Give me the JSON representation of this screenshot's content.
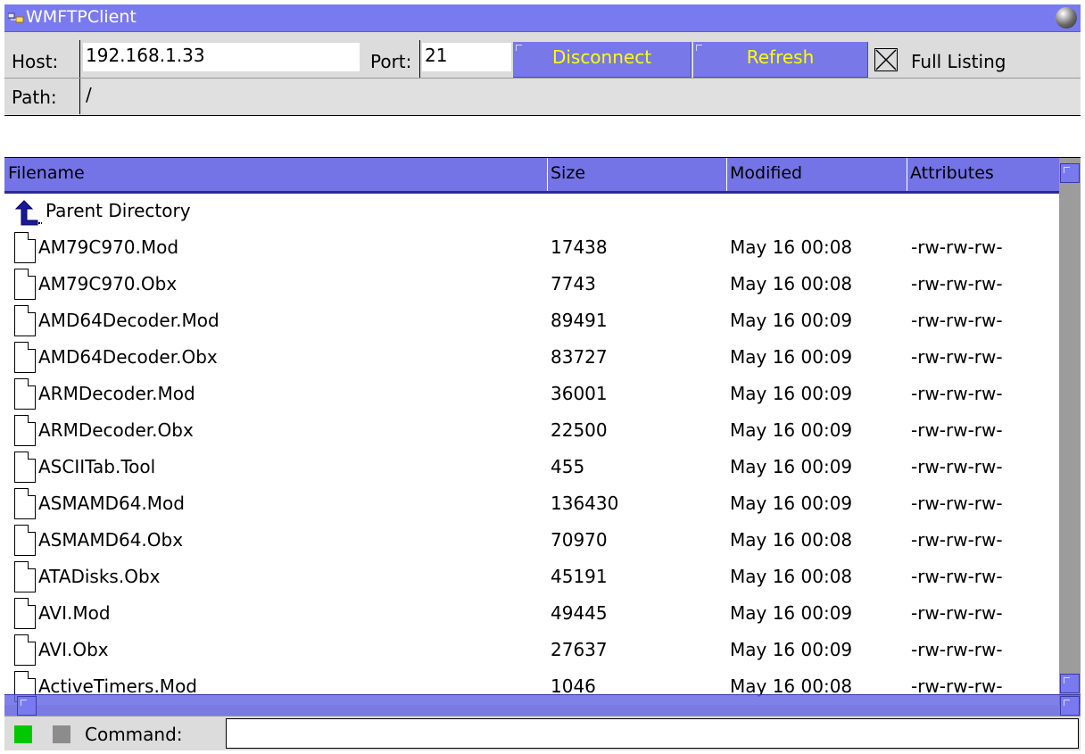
{
  "window": {
    "title": "WMFTPClient",
    "close_icon": "sphere-close-icon"
  },
  "connection": {
    "host_label": "Host:",
    "host_value": "192.168.1.33",
    "port_label": "Port:",
    "port_value": "21",
    "disconnect_label": "Disconnect",
    "refresh_label": "Refresh",
    "full_listing_label": "Full Listing",
    "full_listing_checked": true,
    "path_label": "Path:",
    "path_value": "/"
  },
  "table": {
    "columns": [
      "Filename",
      "Size",
      "Modified",
      "Attributes"
    ],
    "parent_label": "Parent Directory",
    "rows": [
      {
        "name": "AM79C970.Mod",
        "size": "17438",
        "modified": "May 16 00:08",
        "attrs": "-rw-rw-rw-"
      },
      {
        "name": "AM79C970.Obx",
        "size": "7743",
        "modified": "May 16 00:08",
        "attrs": "-rw-rw-rw-"
      },
      {
        "name": "AMD64Decoder.Mod",
        "size": "89491",
        "modified": "May 16 00:09",
        "attrs": "-rw-rw-rw-"
      },
      {
        "name": "AMD64Decoder.Obx",
        "size": "83727",
        "modified": "May 16 00:09",
        "attrs": "-rw-rw-rw-"
      },
      {
        "name": "ARMDecoder.Mod",
        "size": "36001",
        "modified": "May 16 00:09",
        "attrs": "-rw-rw-rw-"
      },
      {
        "name": "ARMDecoder.Obx",
        "size": "22500",
        "modified": "May 16 00:09",
        "attrs": "-rw-rw-rw-"
      },
      {
        "name": "ASCIITab.Tool",
        "size": "455",
        "modified": "May 16 00:09",
        "attrs": "-rw-rw-rw-"
      },
      {
        "name": "ASMAMD64.Mod",
        "size": "136430",
        "modified": "May 16 00:09",
        "attrs": "-rw-rw-rw-"
      },
      {
        "name": "ASMAMD64.Obx",
        "size": "70970",
        "modified": "May 16 00:08",
        "attrs": "-rw-rw-rw-"
      },
      {
        "name": "ATADisks.Obx",
        "size": "45191",
        "modified": "May 16 00:08",
        "attrs": "-rw-rw-rw-"
      },
      {
        "name": "AVI.Mod",
        "size": "49445",
        "modified": "May 16 00:09",
        "attrs": "-rw-rw-rw-"
      },
      {
        "name": "AVI.Obx",
        "size": "27637",
        "modified": "May 16 00:09",
        "attrs": "-rw-rw-rw-"
      },
      {
        "name": "ActiveTimers.Mod",
        "size": "1046",
        "modified": "May 16 00:08",
        "attrs": "-rw-rw-rw-"
      }
    ]
  },
  "status": {
    "command_label": "Command:",
    "command_value": "",
    "indicator_colors": [
      "#00c800",
      "#8c8c8c"
    ]
  },
  "colors": {
    "titlebar": "#7a7af0",
    "button_bg": "#7878e8",
    "button_text": "#ffff00",
    "header_bg": "#7474e6"
  }
}
